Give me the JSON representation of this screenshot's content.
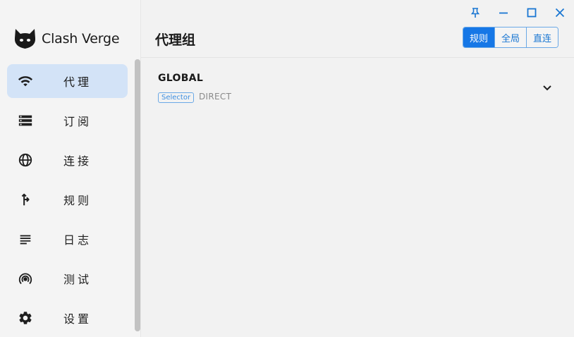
{
  "app": {
    "name": "Clash Verge"
  },
  "sidebar": {
    "items": [
      {
        "label": "代理",
        "icon": "wifi-icon",
        "active": true
      },
      {
        "label": "订阅",
        "icon": "storage-icon",
        "active": false
      },
      {
        "label": "连接",
        "icon": "globe-icon",
        "active": false
      },
      {
        "label": "规则",
        "icon": "fork-arrow-icon",
        "active": false
      },
      {
        "label": "日志",
        "icon": "list-lines-icon",
        "active": false
      },
      {
        "label": "测试",
        "icon": "radar-icon",
        "active": false
      },
      {
        "label": "设置",
        "icon": "gear-icon",
        "active": false
      }
    ]
  },
  "window": {
    "controls": [
      "pin-icon",
      "minimize-icon",
      "maximize-icon",
      "close-icon"
    ]
  },
  "header": {
    "title": "代理组",
    "modes": [
      {
        "label": "规则",
        "active": true
      },
      {
        "label": "全局",
        "active": false
      },
      {
        "label": "直连",
        "active": false
      }
    ]
  },
  "groups": [
    {
      "name": "GLOBAL",
      "type": "Selector",
      "now": "DIRECT",
      "expand_icon": "chevron-down-icon"
    }
  ],
  "colors": {
    "accent": "#1677e6",
    "active_nav_bg": "#d3e3f7",
    "window_control": "#1976d2",
    "background": "#f2f2f2"
  }
}
